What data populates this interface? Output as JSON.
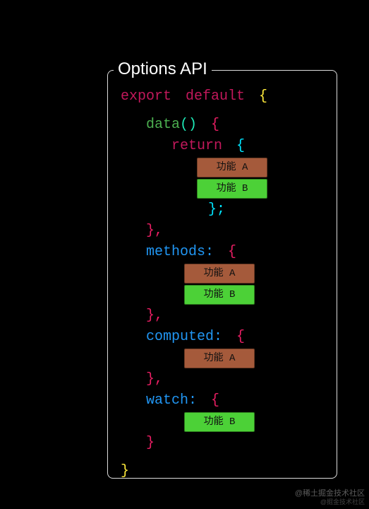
{
  "panel": {
    "legend": "Options API"
  },
  "code": {
    "export": "export",
    "default": "default",
    "braceOpen": "{",
    "braceClose": "}",
    "data": "data",
    "parenOpen": "(",
    "parenClose": ")",
    "return": "return",
    "semicolon": ";",
    "comma": ",",
    "methods": "methods:",
    "computed": "computed:",
    "watch": "watch:"
  },
  "tags": {
    "featureA": "功能 A",
    "featureB": "功能 B"
  },
  "watermark": {
    "line1": "@稀土掘金技术社区",
    "line2": "@掘金技术社区"
  }
}
